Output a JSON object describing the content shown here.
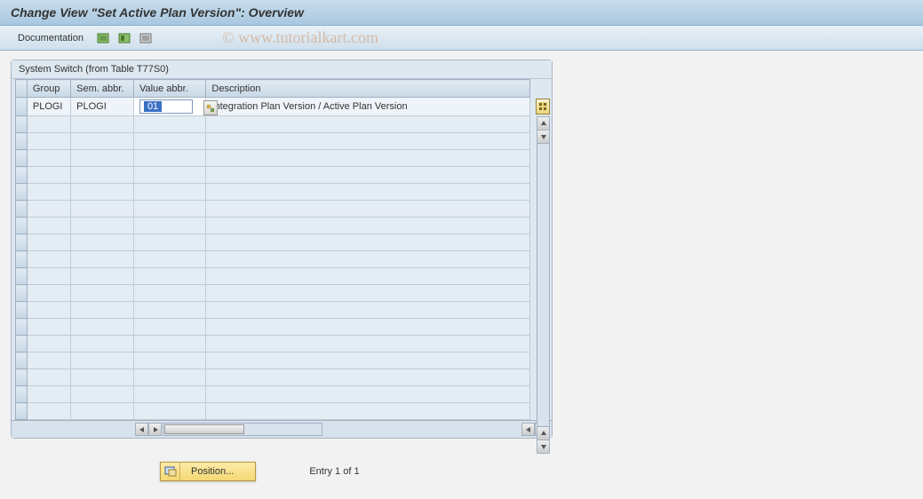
{
  "title": "Change View \"Set Active Plan Version\": Overview",
  "toolbar": {
    "documentation_label": "Documentation"
  },
  "watermark": "© www.tutorialkart.com",
  "panel": {
    "title": "System Switch (from Table T77S0)",
    "columns": {
      "group": "Group",
      "sem": "Sem. abbr.",
      "val": "Value abbr.",
      "desc": "Description"
    },
    "rows": [
      {
        "group": "PLOGI",
        "sem": "PLOGI",
        "val": "01",
        "desc": "Integration Plan Version / Active Plan Version"
      }
    ]
  },
  "bottom": {
    "position_label": "Position...",
    "entry_text": "Entry 1 of 1"
  }
}
